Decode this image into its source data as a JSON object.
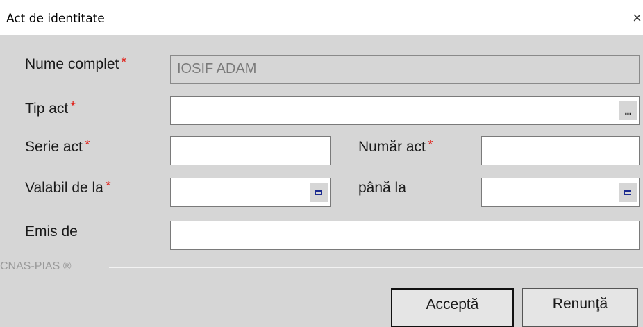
{
  "dialog": {
    "title": "Act de identitate",
    "close_glyph": "×"
  },
  "form": {
    "nume_complet": {
      "label": "Nume complet",
      "required": "*",
      "value": "IOSIF ADAM"
    },
    "tip_act": {
      "label": "Tip act",
      "required": "*",
      "value": "",
      "picker_label": "..."
    },
    "serie_act": {
      "label": "Serie act",
      "required": "*",
      "value": ""
    },
    "numar_act": {
      "label": "Număr act",
      "required": "*",
      "value": ""
    },
    "valabil_de_la": {
      "label": "Valabil de la",
      "required": "*",
      "value": "",
      "icon": "calendar-icon"
    },
    "pana_la": {
      "label": "până la",
      "value": "",
      "icon": "calendar-icon"
    },
    "emis_de": {
      "label": "Emis de",
      "value": ""
    }
  },
  "footer": {
    "brand": "CNAS-PIAS ®"
  },
  "buttons": {
    "accept": "Acceptă",
    "cancel": "Renunţă"
  },
  "colors": {
    "panel_bg": "#d6d6d6",
    "required_marker": "#e0231c",
    "calendar_icon": "#1c2b8f"
  }
}
